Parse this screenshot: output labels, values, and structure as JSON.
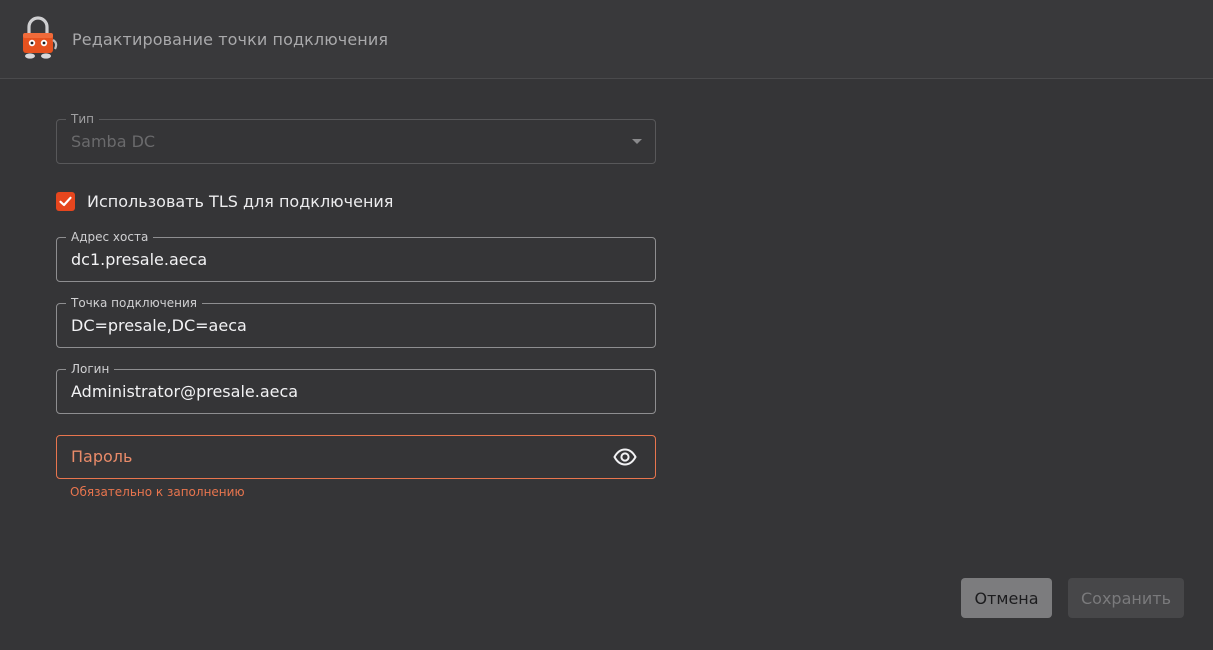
{
  "header": {
    "title": "Редактирование точки подключения"
  },
  "form": {
    "type": {
      "label": "Тип",
      "value": "Samba DC",
      "disabled": true
    },
    "use_tls": {
      "label": "Использовать TLS для подключения",
      "checked": true
    },
    "host": {
      "label": "Адрес хоста",
      "value": "dc1.presale.aeca"
    },
    "base_dn": {
      "label": "Точка подключения",
      "value": "DC=presale,DC=aeca"
    },
    "login": {
      "label": "Логин",
      "value": "Administrator@presale.aeca"
    },
    "password": {
      "placeholder": "Пароль",
      "value": "",
      "error": "Обязательно к заполнению",
      "toggle_icon": "eye-icon"
    }
  },
  "actions": {
    "cancel_label": "Отмена",
    "save_label": "Сохранить",
    "save_disabled": true
  },
  "colors": {
    "accent": "#e6461e",
    "error": "#e8754e",
    "background": "#353537"
  }
}
